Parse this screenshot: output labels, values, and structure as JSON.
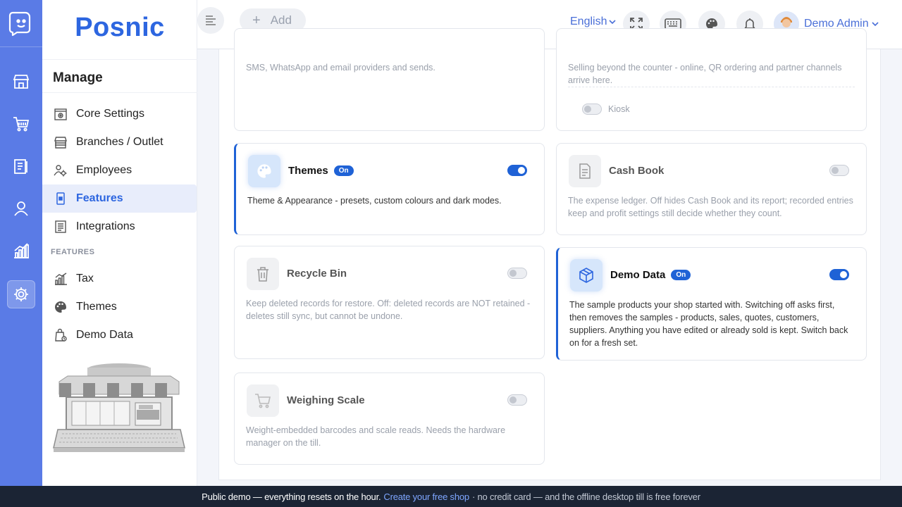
{
  "app": {
    "brand": "Posnic"
  },
  "colors": {
    "accent": "#2d66e0",
    "rail": "#5a7be6",
    "toggle_on": "#1f62d6",
    "footer_bg": "#1b2434"
  },
  "rail": {
    "items": [
      {
        "icon": "store-icon"
      },
      {
        "icon": "cart-icon"
      },
      {
        "icon": "clipboard-icon"
      },
      {
        "icon": "user-icon"
      },
      {
        "icon": "chart-icon"
      },
      {
        "icon": "gear-icon",
        "active": true
      }
    ]
  },
  "menu": {
    "title": "Manage",
    "items": [
      {
        "label": "Core Settings",
        "icon": "settings-doc-icon"
      },
      {
        "label": "Branches / Outlet",
        "icon": "store-icon"
      },
      {
        "label": "Employees",
        "icon": "users-gear-icon"
      },
      {
        "label": "Features",
        "icon": "device-icon",
        "active": true
      },
      {
        "label": "Integrations",
        "icon": "list-icon"
      }
    ],
    "section_label": "FEATURES",
    "feature_items": [
      {
        "label": "Tax",
        "icon": "chart-icon"
      },
      {
        "label": "Themes",
        "icon": "palette-icon"
      },
      {
        "label": "Demo Data",
        "icon": "bag-icon"
      }
    ]
  },
  "topbar": {
    "add_label": "Add",
    "language": "English",
    "user_name": "Demo Admin"
  },
  "cards": {
    "notifications": {
      "desc": "SMS, WhatsApp and email providers and sends."
    },
    "channels": {
      "desc": "Selling beyond the counter - online, QR ordering and partner channels arrive here.",
      "sub_toggle_label": "Kiosk"
    },
    "themes": {
      "title": "Themes",
      "badge": "On",
      "enabled": true,
      "desc": "Theme & Appearance - presets, custom colours and dark modes."
    },
    "cash_book": {
      "title": "Cash Book",
      "enabled": false,
      "desc": "The expense ledger. Off hides Cash Book and its report; recorded entries keep and profit settings still decide whether they count."
    },
    "recycle_bin": {
      "title": "Recycle Bin",
      "enabled": false,
      "desc": "Keep deleted records for restore. Off: deleted records are NOT retained - deletes still sync, but cannot be undone."
    },
    "demo_data": {
      "title": "Demo Data",
      "badge": "On",
      "enabled": true,
      "desc": "The sample products your shop started with. Switching off asks first, then removes the samples - products, sales, quotes, customers, suppliers. Anything you have edited or already sold is kept. Switch back on for a fresh set."
    },
    "weighing_scale": {
      "title": "Weighing Scale",
      "enabled": false,
      "desc": "Weight-embedded barcodes and scale reads. Needs the hardware manager on the till."
    }
  },
  "footer": {
    "text": "Public demo — everything resets on the hour.",
    "link": "Create your free shop",
    "rest": "· no credit card — and the offline desktop till is free forever"
  }
}
